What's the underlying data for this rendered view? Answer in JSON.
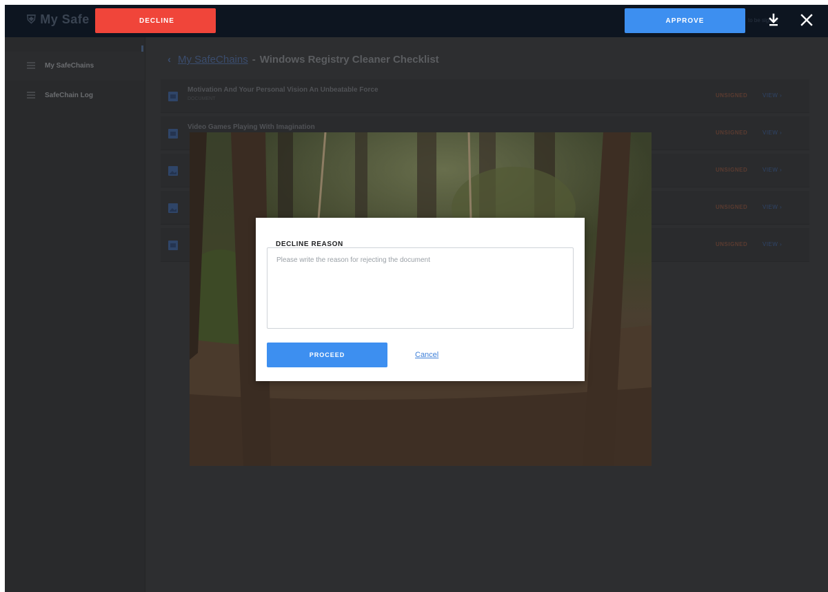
{
  "topbar": {
    "brand": "My Safe",
    "decline_label": "DECLINE",
    "approve_label": "APPROVE",
    "faint_text": "to be signed"
  },
  "sidebar": {
    "items": [
      {
        "label": "My SafeChains",
        "icon": "list-icon",
        "active": true
      },
      {
        "label": "SafeChain Log",
        "icon": "list-icon",
        "active": false
      }
    ]
  },
  "breadcrumb": {
    "back": "‹",
    "link": "My SafeChains",
    "separator": "-",
    "current": "Windows Registry Cleaner Checklist"
  },
  "documents": [
    {
      "title": "Motivation And Your Personal Vision An Unbeatable Force",
      "subtitle": "DOCUMENT",
      "status": "UNSIGNED",
      "action": "VIEW ›"
    },
    {
      "title": "Video Games Playing With Imagination",
      "subtitle": "",
      "status": "UNSIGNED",
      "action": "VIEW ›"
    },
    {
      "title": "",
      "subtitle": "",
      "status": "UNSIGNED",
      "action": "VIEW ›"
    },
    {
      "title": "",
      "subtitle": "",
      "status": "UNSIGNED",
      "action": "VIEW ›"
    },
    {
      "title": "",
      "subtitle": "",
      "status": "UNSIGNED",
      "action": "VIEW ›"
    }
  ],
  "modal": {
    "title": "DECLINE REASON",
    "textarea_placeholder": "Please write the reason for rejecting the document",
    "textarea_value": "",
    "proceed_label": "PROCEED",
    "cancel_label": "Cancel"
  },
  "colors": {
    "decline": "#f0453a",
    "approve": "#3d8ff0",
    "topbar": "#0d1520",
    "overlay": "#2d2e30"
  }
}
